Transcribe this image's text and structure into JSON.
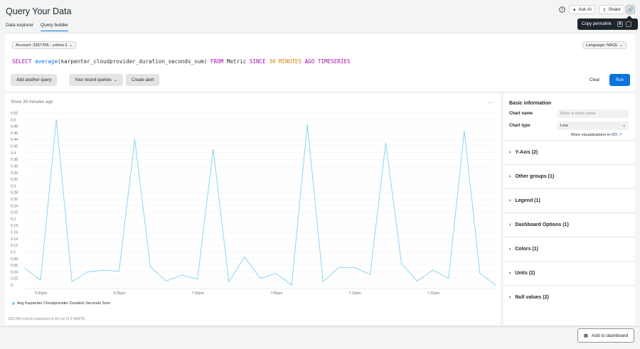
{
  "header": {
    "title": "Query Your Data",
    "tabs": [
      {
        "label": "Data explorer"
      },
      {
        "label": "Query builder"
      }
    ],
    "ask_ai_label": "Ask AI",
    "share_label": "Share",
    "tooltip": "Copy permalink",
    "tooltip_keys": [
      "⌘",
      "."
    ]
  },
  "query": {
    "account": "Account: 3357766 - yohira-1",
    "language": "Language: NRQL",
    "nrql": {
      "select": "SELECT",
      "func": "average",
      "arg": "(karpenter_cloudprovider_duration_seconds_sum)",
      "from": "FROM",
      "table": "Metric",
      "since": "SINCE",
      "num": "30",
      "unit": "MINUTES",
      "ago": "AGO",
      "ts": "TIMESERIES"
    },
    "buttons": {
      "add_query": "Add another query",
      "recent": "Your recent queries",
      "create_alert": "Create alert",
      "clear": "Clear",
      "run": "Run"
    }
  },
  "chart": {
    "header_label": "Since 30 minutes ago",
    "more": "...",
    "footer_text": "392,586 events inspected in 66 ms (5.9 MEPS)",
    "colors": {
      "line": "#7fd0f5"
    }
  },
  "chart_data": {
    "type": "line",
    "title": "",
    "xlabel": "",
    "ylabel": "",
    "ylim": [
      0,
      0.52
    ],
    "yticks": [
      "0.52",
      "0.5",
      "0.48",
      "0.46",
      "0.44",
      "0.42",
      "0.4",
      "0.38",
      "0.36",
      "0.34",
      "0.32",
      "0.3",
      "0.28",
      "0.26",
      "0.24",
      "0.22",
      "0.2",
      "0.18",
      "0.16",
      "0.14",
      "0.12",
      "0.1",
      "0.08",
      "0.06",
      "0.04",
      "0.02",
      "0"
    ],
    "xticks": [
      "6:50pm",
      "6:55pm",
      "7:00pm",
      "7:05pm",
      "7:10pm",
      "7:15pm"
    ],
    "x": [
      "6:49pm",
      "6:50pm",
      "6:51pm",
      "6:52pm",
      "6:53pm",
      "6:54pm",
      "6:55pm",
      "6:56pm",
      "6:57pm",
      "6:58pm",
      "6:59pm",
      "7:00pm",
      "7:01pm",
      "7:02pm",
      "7:03pm",
      "7:04pm",
      "7:05pm",
      "7:06pm",
      "7:07pm",
      "7:08pm",
      "7:09pm",
      "7:10pm",
      "7:11pm",
      "7:12pm",
      "7:13pm",
      "7:14pm",
      "7:15pm",
      "7:16pm",
      "7:17pm",
      "7:18pm",
      "7:19pm"
    ],
    "series": [
      {
        "name": "Avg Karpenter Cloudprovider Duration Seconds Sum",
        "values": [
          0.05,
          0.015,
          0.5,
          0.01,
          0.04,
          0.045,
          0.042,
          0.44,
          0.055,
          0.012,
          0.03,
          0.018,
          0.41,
          0.01,
          0.085,
          0.02,
          0.035,
          0.0,
          0.485,
          0.01,
          0.053,
          0.053,
          0.032,
          0.43,
          0.065,
          0.012,
          0.045,
          0.02,
          0.465,
          0.035,
          0.0
        ]
      }
    ],
    "grid": true,
    "legend": "bottom-left"
  },
  "side": {
    "title": "Basic information",
    "chart_name_label": "Chart name",
    "chart_name_placeholder": "Enter a chart name",
    "chart_type_label": "Chart type",
    "chart_type_value": "Line",
    "more_viz": "More visualizations in I/O",
    "sections": [
      {
        "label": "Y-Axis (2)"
      },
      {
        "label": "Other groups (1)"
      },
      {
        "label": "Legend (1)"
      },
      {
        "label": "Dashboard Options (1)"
      },
      {
        "label": "Colors (1)"
      },
      {
        "label": "Units (2)"
      },
      {
        "label": "Null values (2)"
      }
    ]
  },
  "footer": {
    "add_dashboard": "Add to dashboard"
  }
}
